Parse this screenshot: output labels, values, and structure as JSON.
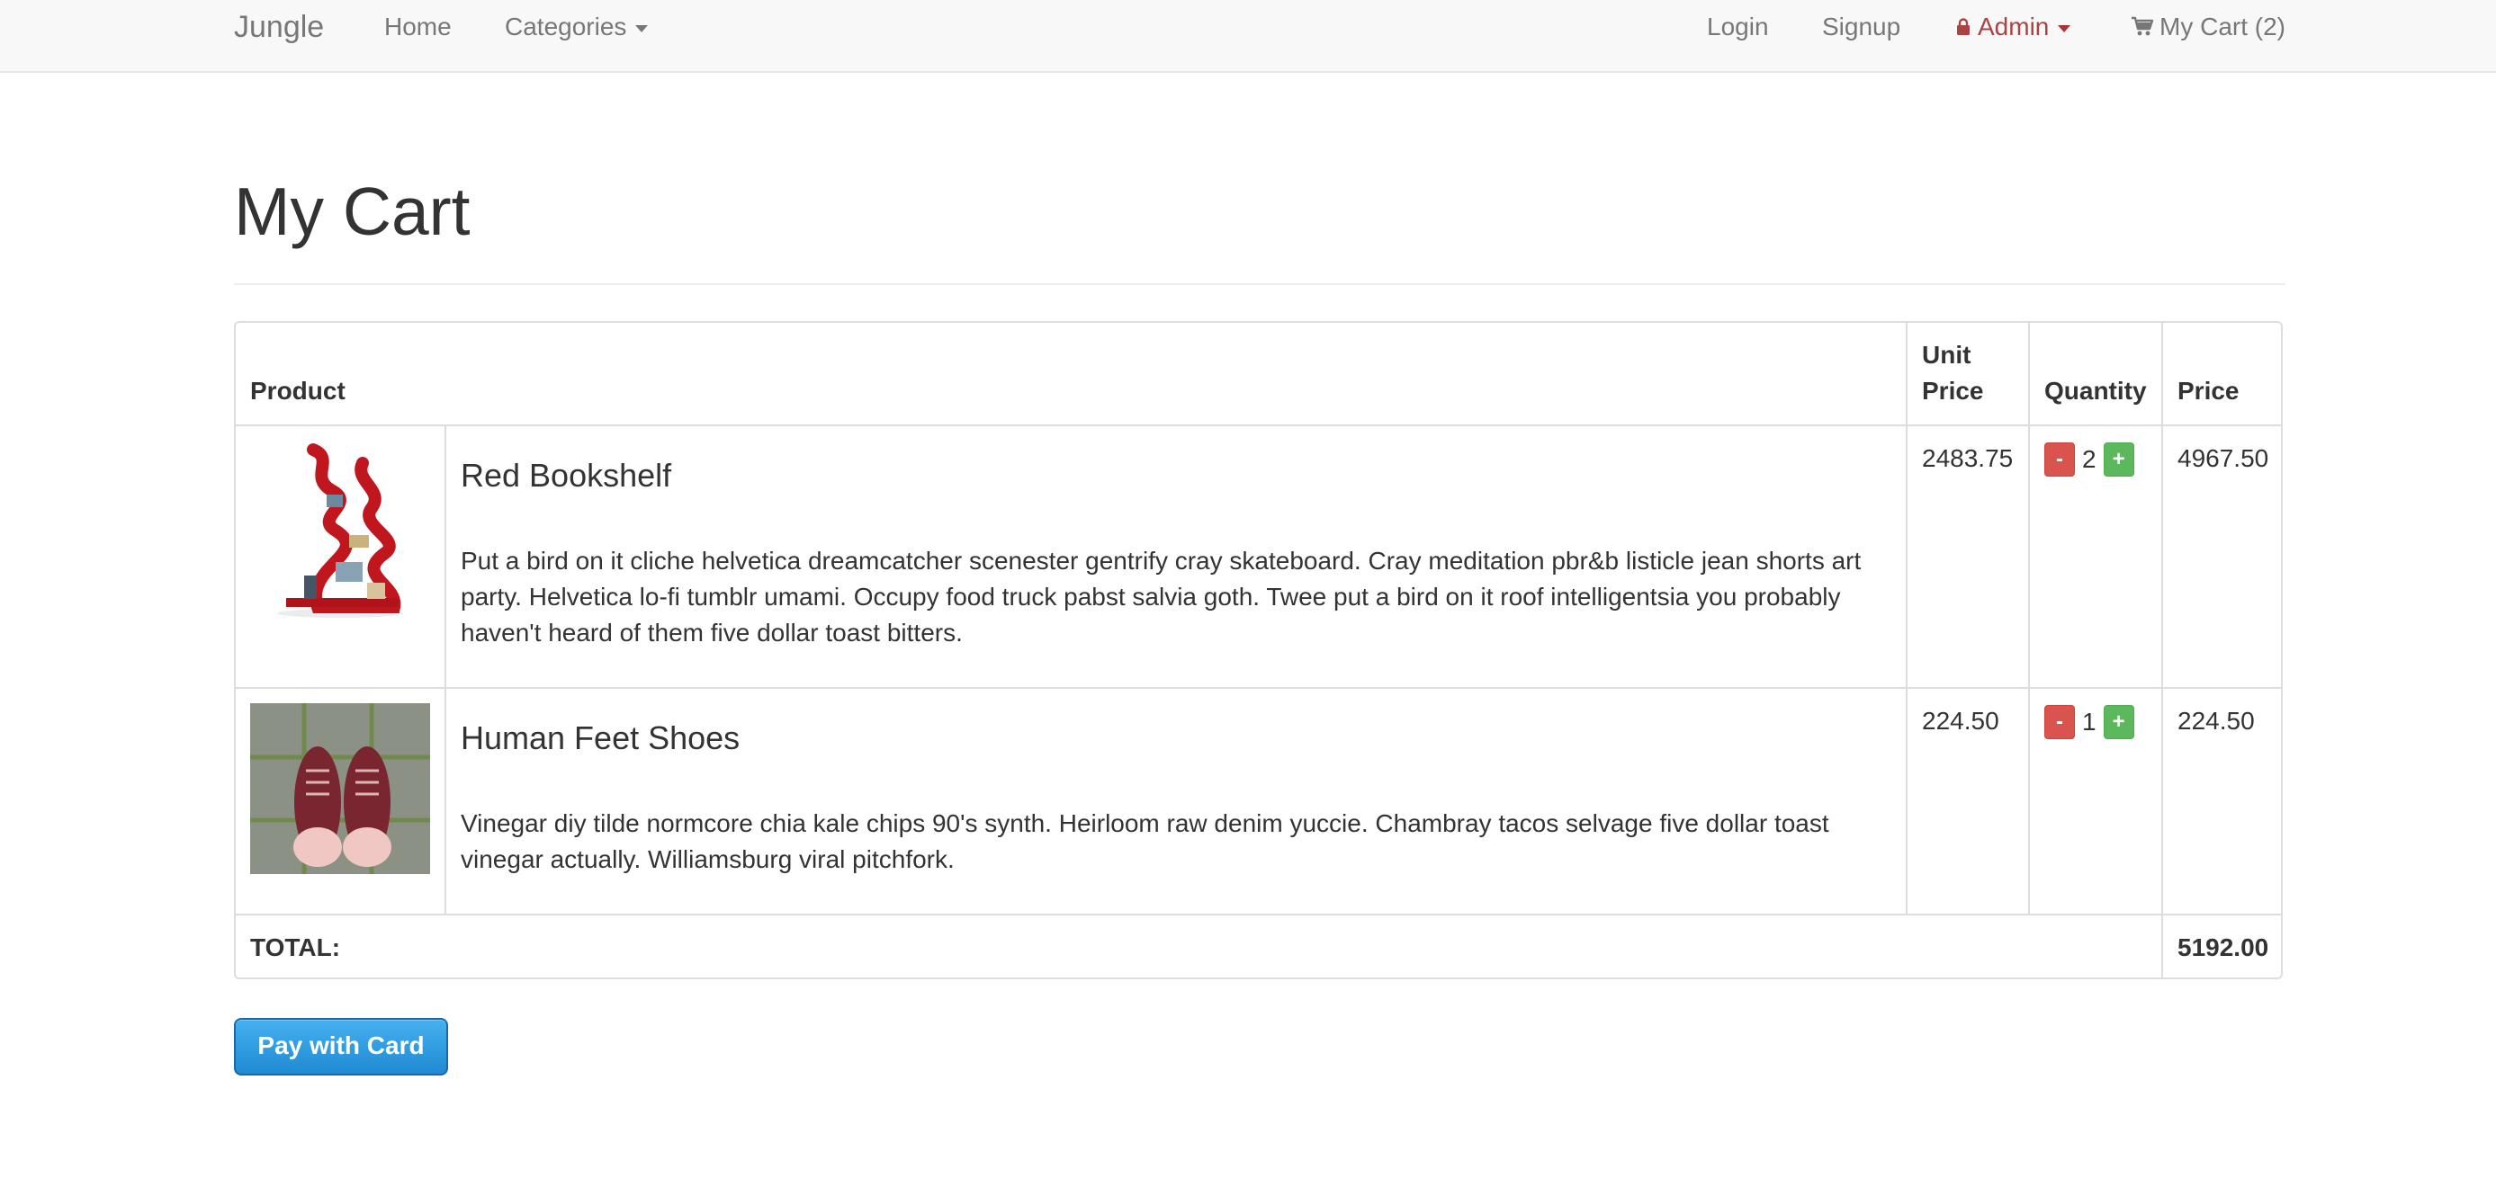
{
  "navbar": {
    "brand": "Jungle",
    "home": "Home",
    "categories": "Categories",
    "login": "Login",
    "signup": "Signup",
    "admin": "Admin",
    "cart": "My Cart (2)"
  },
  "page": {
    "title": "My Cart"
  },
  "table": {
    "headers": {
      "product": "Product",
      "unit_price": "Unit Price",
      "quantity": "Quantity",
      "price": "Price"
    },
    "rows": [
      {
        "name": "Red Bookshelf",
        "description": "Put a bird on it cliche helvetica dreamcatcher scenester gentrify cray skateboard. Cray meditation pbr&b listicle jean shorts art party. Helvetica lo-fi tumblr umami. Occupy food truck pabst salvia goth. Twee put a bird on it roof intelligentsia you probably haven't heard of them five dollar toast bitters.",
        "unit_price": "2483.75",
        "quantity": "2",
        "price": "4967.50",
        "minus": "-",
        "plus": "+"
      },
      {
        "name": "Human Feet Shoes",
        "description": "Vinegar diy tilde normcore chia kale chips 90's synth. Heirloom raw denim yuccie. Chambray tacos selvage five dollar toast vinegar actually. Williamsburg viral pitchfork.",
        "unit_price": "224.50",
        "quantity": "1",
        "price": "224.50",
        "minus": "-",
        "plus": "+"
      }
    ],
    "total_label": "TOTAL:",
    "total_value": "5192.00"
  },
  "pay_button": "Pay with Card",
  "colors": {
    "navbar_bg": "#f8f8f8",
    "admin": "#a94442",
    "danger": "#d9534f",
    "success": "#5cb85c",
    "pay_button": "#2b98de"
  }
}
